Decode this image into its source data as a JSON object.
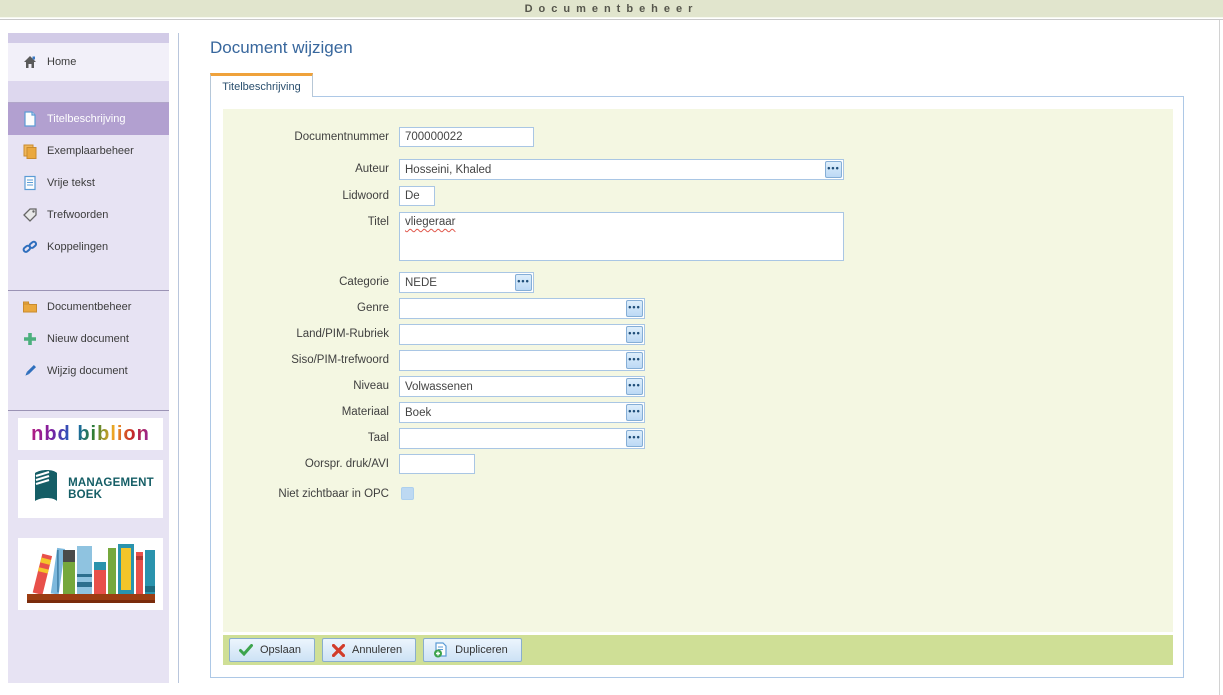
{
  "banner": {
    "title": "Documentbeheer"
  },
  "sidebar": {
    "home": "Home",
    "nav": [
      "Titelbeschrijving",
      "Exemplaarbeheer",
      "Vrije tekst",
      "Trefwoorden",
      "Koppelingen"
    ],
    "actions": [
      "Documentbeheer",
      "Nieuw document",
      "Wijzig document"
    ],
    "logos": {
      "nbd": "nbd biblion",
      "mgmt_line1": "MANAGEMENT",
      "mgmt_line2": "BOEK"
    },
    "icons": {
      "home": "home-icon",
      "titel": "page-icon",
      "exemplaar": "copy-pages-icon",
      "vrije": "text-page-icon",
      "trefwoorden": "tag-icon",
      "koppelingen": "link-icon",
      "docbeheer": "folder-icon",
      "nieuw": "plus-icon",
      "wijzig": "pencil-icon"
    }
  },
  "main": {
    "title": "Document wijzigen",
    "tab": "Titelbeschrijving",
    "form": {
      "fields": [
        {
          "label": "Documentnummer",
          "value": "700000022"
        },
        {
          "label": "Auteur",
          "value": "Hosseini, Khaled"
        },
        {
          "label": "Lidwoord",
          "value": "De"
        },
        {
          "label": "Titel",
          "value": "vliegeraar"
        },
        {
          "label": "Categorie",
          "value": "NEDE"
        },
        {
          "label": "Genre",
          "value": ""
        },
        {
          "label": "Land/PIM-Rubriek",
          "value": ""
        },
        {
          "label": "Siso/PIM-trefwoord",
          "value": ""
        },
        {
          "label": "Niveau",
          "value": "Volwassenen"
        },
        {
          "label": "Materiaal",
          "value": "Boek"
        },
        {
          "label": "Taal",
          "value": ""
        },
        {
          "label": "Oorspr. druk/AVI",
          "value": ""
        },
        {
          "label": "Niet zichtbaar in OPC",
          "checked": false
        }
      ]
    },
    "buttons": [
      {
        "label": "Opslaan",
        "icon": "check-icon"
      },
      {
        "label": "Annuleren",
        "icon": "cross-icon"
      },
      {
        "label": "Dupliceren",
        "icon": "duplicate-doc-icon"
      }
    ]
  },
  "colors": {
    "banner_bg": "#e1e5cd",
    "sidebar_bg": "#e7e3f3",
    "selected_item_bg": "#b2a0d0",
    "heading_blue": "#38679d",
    "tab_accent_orange": "#efa23b",
    "panel_yellow": "#f4f7e2",
    "buttonbar_green": "#cfdf96",
    "field_border_blue": "#a9c6e4",
    "squiggle_red": "#e0564a",
    "mgmt_teal": "#155e66"
  }
}
